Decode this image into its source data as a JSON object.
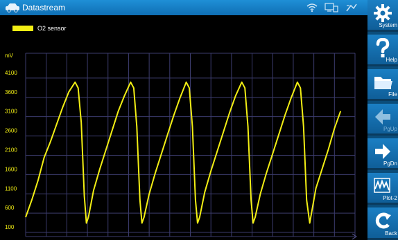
{
  "window": {
    "title": "Datastream"
  },
  "status_icons": [
    "wifi-icon",
    "device-connection-icon",
    "vci-link-icon"
  ],
  "legend": {
    "label": "O2 sensor",
    "color": "#f2ee14"
  },
  "chart_data": {
    "type": "line",
    "ylabel": "mV",
    "y_ticks": [
      4100,
      3600,
      3100,
      2600,
      2100,
      1600,
      1100,
      600,
      100
    ],
    "ylim": [
      -150,
      4600
    ],
    "x_divisions": 16,
    "grid": true,
    "series": [
      {
        "name": "O2 sensor",
        "color": "#f2ee14",
        "x": [
          0,
          0.3,
          0.6,
          0.9,
          1.2,
          1.5,
          1.8,
          2.1,
          2.4,
          2.55,
          2.7,
          2.85,
          2.95,
          3.05,
          3.3,
          3.6,
          3.9,
          4.2,
          4.5,
          4.8,
          5.1,
          5.25,
          5.4,
          5.55,
          5.65,
          5.75,
          6.0,
          6.3,
          6.6,
          6.9,
          7.2,
          7.5,
          7.8,
          7.95,
          8.1,
          8.25,
          8.35,
          8.45,
          8.7,
          9.0,
          9.3,
          9.6,
          9.9,
          10.2,
          10.5,
          10.65,
          10.8,
          10.95,
          11.05,
          11.15,
          11.4,
          11.7,
          12.0,
          12.3,
          12.6,
          12.9,
          13.2,
          13.35,
          13.5,
          13.65,
          13.8,
          14.1,
          14.4,
          14.7,
          15.0,
          15.3
        ],
        "values": [
          350,
          800,
          1300,
          1900,
          2300,
          2750,
          3200,
          3600,
          3850,
          3700,
          2800,
          900,
          200,
          350,
          1050,
          1600,
          2100,
          2600,
          3100,
          3500,
          3850,
          3700,
          2700,
          800,
          200,
          350,
          950,
          1500,
          2000,
          2500,
          3000,
          3450,
          3850,
          3700,
          2700,
          800,
          200,
          350,
          1000,
          1550,
          2050,
          2550,
          3050,
          3500,
          3850,
          3700,
          2700,
          800,
          200,
          350,
          950,
          1500,
          2000,
          2500,
          3000,
          3450,
          3850,
          3700,
          2700,
          800,
          200,
          1100,
          1600,
          2100,
          2650,
          3100
        ]
      }
    ]
  },
  "sidebar": [
    {
      "label": "System",
      "icon": "gear-icon"
    },
    {
      "label": "Help",
      "icon": "help-icon"
    },
    {
      "label": "File",
      "icon": "folder-icon"
    },
    {
      "label": "PgUp",
      "icon": "arrow-left-icon",
      "disabled": true
    },
    {
      "label": "PgDn",
      "icon": "arrow-right-icon"
    },
    {
      "label": "Plot-2",
      "icon": "plot-icon"
    },
    {
      "label": "Back",
      "icon": "back-icon"
    }
  ]
}
